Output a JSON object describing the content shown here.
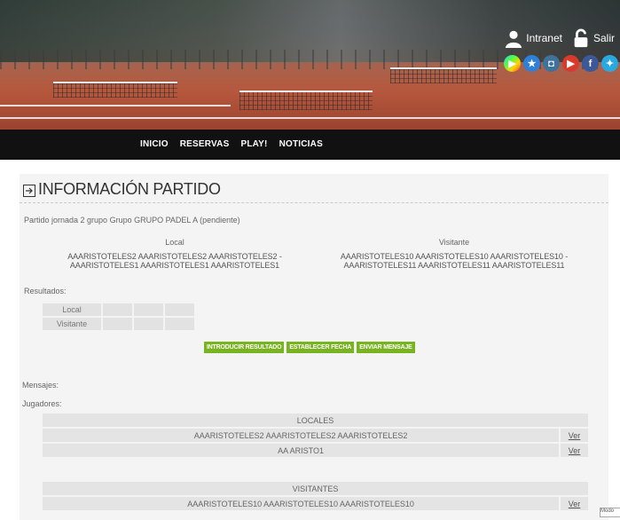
{
  "header": {
    "intranet_label": "Intranet",
    "logout_label": "Salir",
    "social_icons": [
      "google-play",
      "app-store",
      "instagram",
      "youtube",
      "facebook",
      "twitter"
    ]
  },
  "nav": {
    "items": [
      "INICIO",
      "RESERVAS",
      "PLAY!",
      "NOTICIAS"
    ]
  },
  "match": {
    "title": "INFORMACIÓN PARTIDO",
    "subtitle": "Partido jornada 2 grupo Grupo GRUPO PADEL A (pendiente)",
    "local_heading": "Local",
    "visitor_heading": "Visitante",
    "local_names_line1": "AAARISTOTELES2 AAARISTOTELES2 AAARISTOTELES2 -",
    "local_names_line2": "AAARISTOTELES1 AAARISTOTELES1 AAARISTOTELES1",
    "visitor_names_line1": "AAARISTOTELES10 AAARISTOTELES10 AAARISTOTELES10 -",
    "visitor_names_line2": "AAARISTOTELES11 AAARISTOTELES11 AAARISTOTELES11",
    "results_label": "Resultados:",
    "results_rows": [
      "Local",
      "Visitante"
    ],
    "buttons": {
      "enter_result": "INTRODUCIR RESULTADO",
      "set_date": "ESTABLECER FECHA",
      "send_message": "ENVIAR MENSAJE"
    },
    "messages_label": "Mensajes:",
    "players_label": "Jugadores:",
    "locals_heading": "LOCALES",
    "locals": [
      {
        "name": "AAARISTOTELES2 AAARISTOTELES2 AAARISTOTELES2",
        "link": "Ver"
      },
      {
        "name": "AA ARISTO1",
        "link": "Ver"
      }
    ],
    "visitors_heading": "VISITANTES",
    "visitors": [
      {
        "name": "AAARISTOTELES10 AAARISTOTELES10 AAARISTOTELES10",
        "link": "Ver"
      }
    ]
  },
  "edge_hint": "Modo",
  "colors": {
    "nav_bg": "#111111",
    "button_green": "#78b41f",
    "panel_bg": "#f4f4f4"
  }
}
